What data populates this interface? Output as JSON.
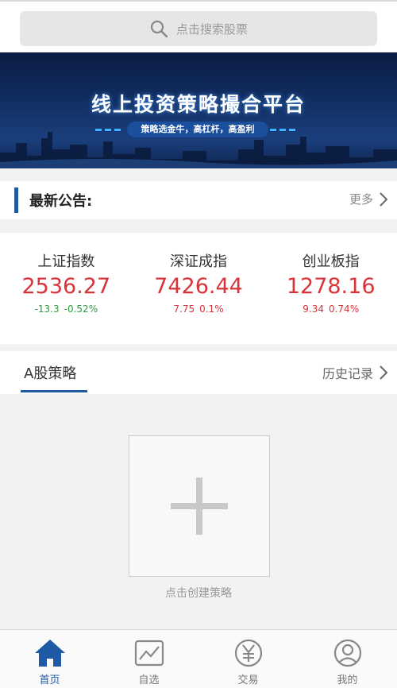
{
  "search": {
    "placeholder": "点击搜索股票"
  },
  "banner": {
    "title": "线上投资策略撮合平台",
    "subtitle": "策略选金牛，高杠杆，高盈利"
  },
  "notice": {
    "title": "最新公告:",
    "more_label": "更多"
  },
  "indices": [
    {
      "name": "上证指数",
      "value": "2536.27",
      "change": "-13.3",
      "percent": "-0.52%",
      "direction": "down"
    },
    {
      "name": "深证成指",
      "value": "7426.44",
      "change": "7.75",
      "percent": "0.1%",
      "direction": "up"
    },
    {
      "name": "创业板指",
      "value": "1278.16",
      "change": "9.34",
      "percent": "0.74%",
      "direction": "up"
    }
  ],
  "section": {
    "tab_label": "A股策略",
    "history_label": "历史记录"
  },
  "create": {
    "label": "点击创建策略"
  },
  "tabbar": [
    {
      "label": "首页",
      "icon": "home-icon",
      "active": true
    },
    {
      "label": "自选",
      "icon": "chart-icon",
      "active": false
    },
    {
      "label": "交易",
      "icon": "yen-icon",
      "active": false
    },
    {
      "label": "我的",
      "icon": "user-icon",
      "active": false
    }
  ],
  "colors": {
    "accent": "#1f5aa6",
    "up": "#d9343a",
    "down": "#2e9e3e"
  }
}
